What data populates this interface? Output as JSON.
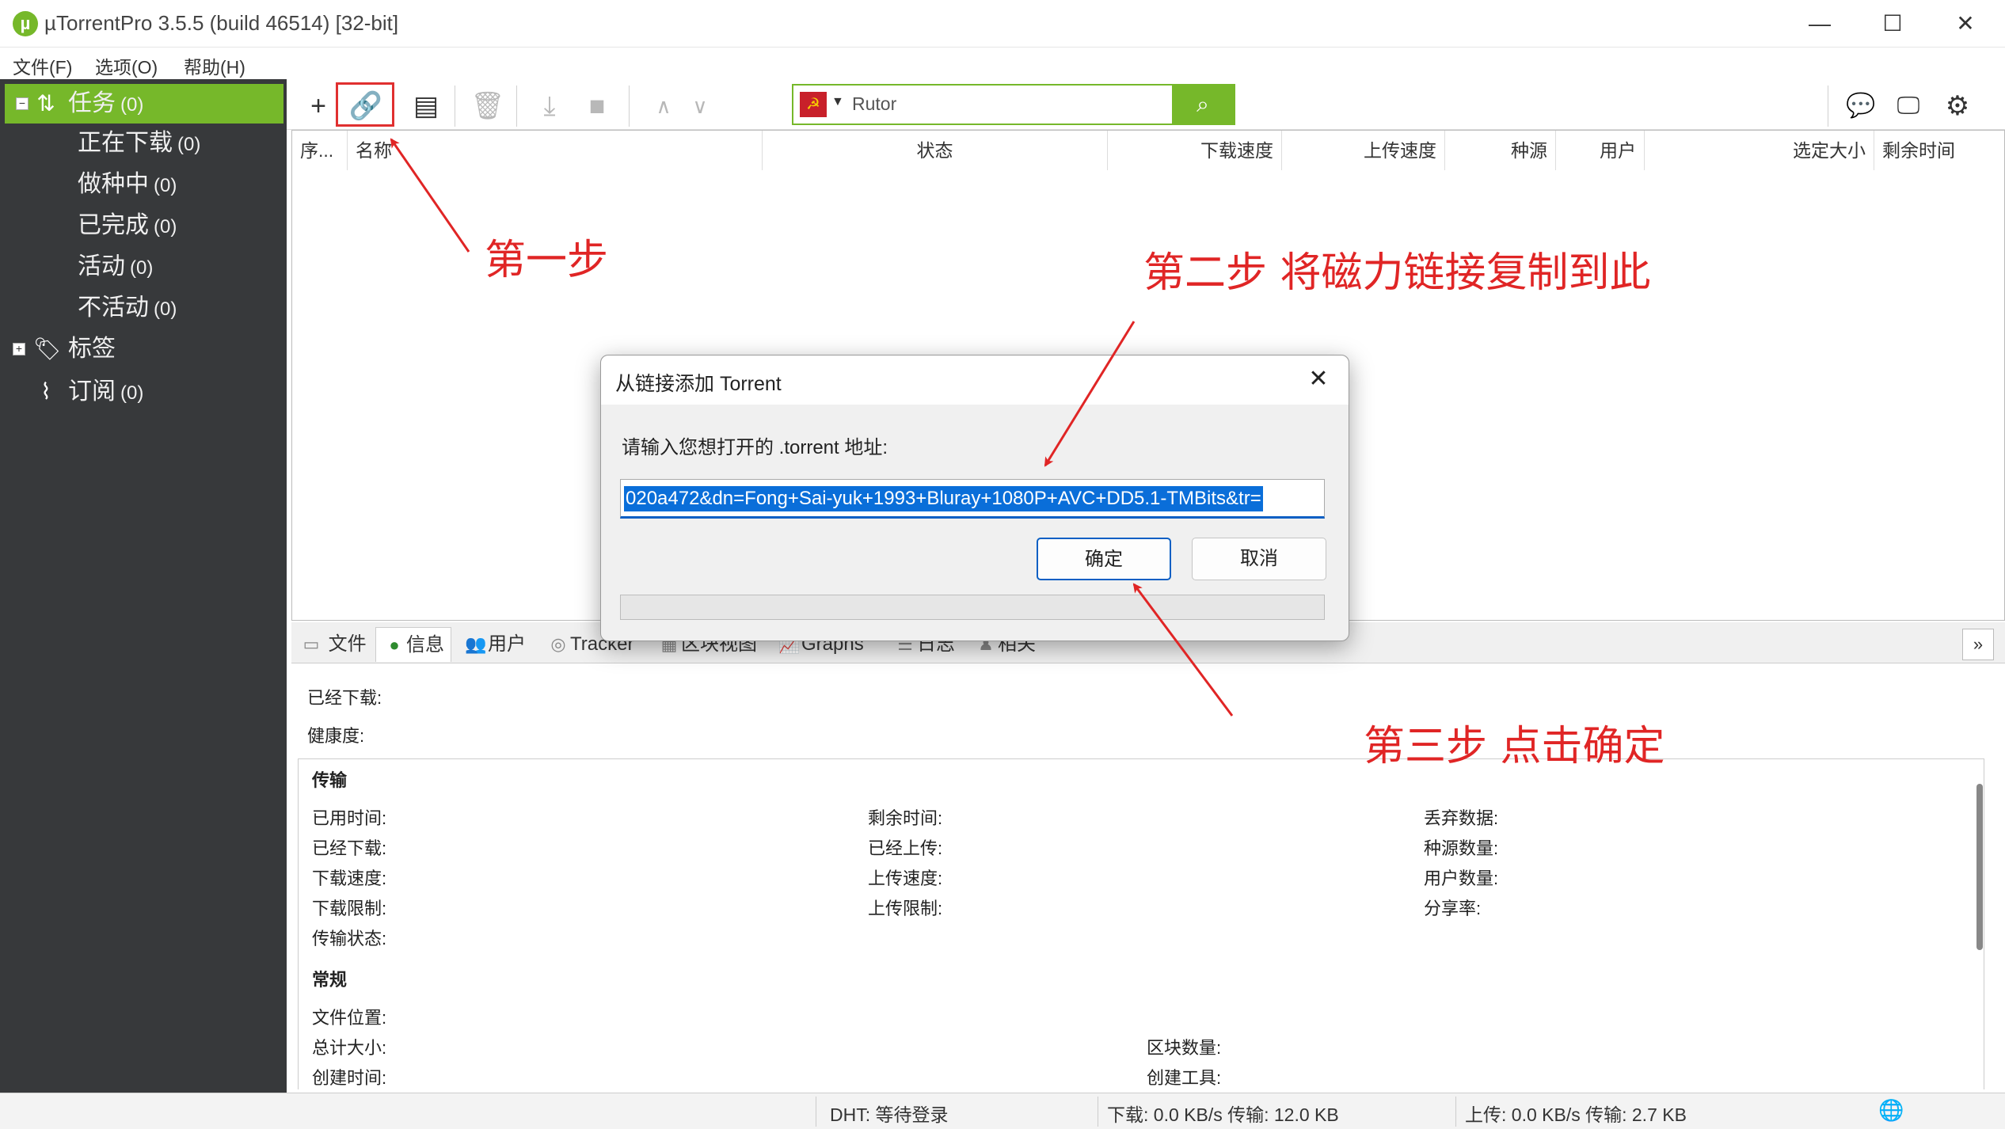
{
  "window": {
    "app_icon": "µ",
    "title": "µTorrentPro 3.5.5  (build 46514) [32-bit]",
    "minimize_glyph": "—",
    "maximize_glyph": "☐",
    "close_glyph": "✕"
  },
  "menu": {
    "file": "文件(F)",
    "options": "选项(O)",
    "help": "帮助(H)"
  },
  "sidebar": {
    "tasks": {
      "label": "任务",
      "count": "(0)"
    },
    "downloading": {
      "label": "正在下载",
      "count": "(0)"
    },
    "seeding": {
      "label": "做种中",
      "count": "(0)"
    },
    "completed": {
      "label": "已完成",
      "count": "(0)"
    },
    "active": {
      "label": "活动",
      "count": "(0)"
    },
    "inactive": {
      "label": "不活动",
      "count": "(0)"
    },
    "labels": {
      "label": "标签"
    },
    "feeds": {
      "label": "订阅",
      "count": "(0)"
    }
  },
  "toolbar": {
    "search_provider": "Rutor",
    "search_placeholder": "Rutor"
  },
  "columns": [
    "序...",
    "名称",
    "状态",
    "下载速度",
    "上传速度",
    "种源",
    "用户",
    "选定大小",
    "剩余时间"
  ],
  "detail_tabs": {
    "files": "文件",
    "info": "信息",
    "peers": "用户",
    "tracker": "Tracker",
    "pieces": "区块视图",
    "graphs": "Graphs",
    "log": "日志",
    "related": "相关"
  },
  "detail": {
    "downloaded": "已经下载:",
    "health": "健康度:",
    "transfer_header": "传输",
    "elapsed": "已用时间:",
    "downloaded2": "已经下载:",
    "dl_speed": "下载速度:",
    "dl_limit": "下载限制:",
    "transfer_status": "传输状态:",
    "remaining": "剩余时间:",
    "uploaded": "已经上传:",
    "ul_speed": "上传速度:",
    "ul_limit": "上传限制:",
    "wasted": "丢弃数据:",
    "seeds": "种源数量:",
    "peers": "用户数量:",
    "ratio": "分享率:",
    "general_header": "常规",
    "save_as": "文件位置:",
    "total_size": "总计大小:",
    "created_on": "创建时间:",
    "pieces": "区块数量:",
    "created_by": "创建工具:"
  },
  "statusbar": {
    "dht": "DHT: 等待登录",
    "download": "下载: 0.0 KB/s 传输: 12.0 KB",
    "upload": "上传: 0.0 KB/s 传输: 2.7 KB"
  },
  "dialog": {
    "title": "从链接添加 Torrent",
    "prompt": "请输入您想打开的 .torrent 地址:",
    "url_value": "020a472&dn=Fong+Sai-yuk+1993+Bluray+1080P+AVC+DD5.1-TMBits&tr=",
    "ok": "确定",
    "cancel": "取消"
  },
  "annotations": {
    "step1": "第一步",
    "step2": "第二步  将磁力链接复制到此",
    "step3": "第三步  点击确定"
  },
  "colors": {
    "accent_green": "#76b82a",
    "sidebar_bg": "#37393b",
    "annotation_red": "#e02525",
    "selection_blue": "#0a6ed9"
  }
}
